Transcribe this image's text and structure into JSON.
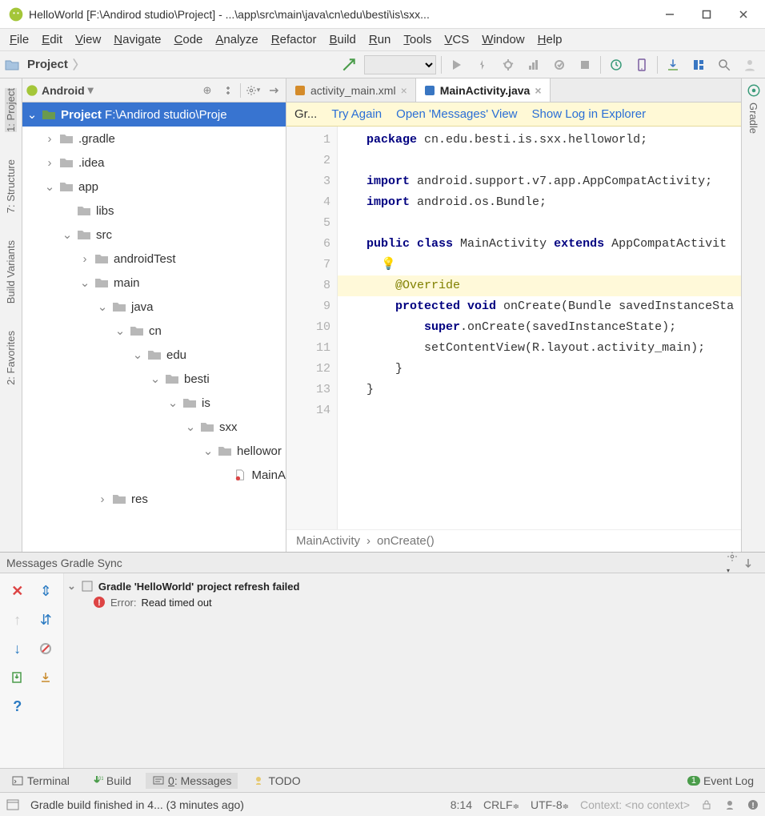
{
  "window": {
    "title": "HelloWorld [F:\\Andirod studio\\Project] - ...\\app\\src\\main\\java\\cn\\edu\\besti\\is\\sxx..."
  },
  "menus": [
    "File",
    "Edit",
    "View",
    "Navigate",
    "Code",
    "Analyze",
    "Refactor",
    "Build",
    "Run",
    "Tools",
    "VCS",
    "Window",
    "Help"
  ],
  "nav_breadcrumb": [
    "Project"
  ],
  "project_pane": {
    "selector_label": "Android",
    "root": {
      "label": "Project",
      "path": "F:\\Andirod studio\\Proje"
    },
    "items": [
      {
        "depth": 1,
        "type": "folder",
        "exp": "closed",
        "name": ".gradle"
      },
      {
        "depth": 1,
        "type": "folder",
        "exp": "closed",
        "name": ".idea"
      },
      {
        "depth": 1,
        "type": "folder",
        "exp": "open",
        "name": "app"
      },
      {
        "depth": 2,
        "type": "folder",
        "exp": "none",
        "name": "libs"
      },
      {
        "depth": 2,
        "type": "folder",
        "exp": "open",
        "name": "src"
      },
      {
        "depth": 3,
        "type": "folder",
        "exp": "closed",
        "name": "androidTest"
      },
      {
        "depth": 3,
        "type": "folder",
        "exp": "open",
        "name": "main"
      },
      {
        "depth": 4,
        "type": "folder",
        "exp": "open",
        "name": "java"
      },
      {
        "depth": 5,
        "type": "folder",
        "exp": "open",
        "name": "cn"
      },
      {
        "depth": 6,
        "type": "folder",
        "exp": "open",
        "name": "edu"
      },
      {
        "depth": 7,
        "type": "folder",
        "exp": "open",
        "name": "besti"
      },
      {
        "depth": 8,
        "type": "folder",
        "exp": "open",
        "name": "is"
      },
      {
        "depth": 9,
        "type": "folder",
        "exp": "open",
        "name": "sxx"
      },
      {
        "depth": 10,
        "type": "folder",
        "exp": "open",
        "name": "hellowor"
      },
      {
        "depth": 11,
        "type": "file",
        "exp": "none",
        "name": "MainA"
      },
      {
        "depth": 4,
        "type": "folder",
        "exp": "closed",
        "name": "res"
      }
    ]
  },
  "editor_tabs": [
    {
      "label": "activity_main.xml",
      "icon": "xml",
      "active": false,
      "closable": true
    },
    {
      "label": "MainActivity.java",
      "icon": "java",
      "active": true,
      "closable": true
    }
  ],
  "editor_notice": {
    "prefix": "Gr...",
    "links": [
      "Try Again",
      "Open 'Messages' View",
      "Show Log in Explorer"
    ]
  },
  "code": {
    "lines": [
      {
        "n": 1,
        "html": "<span class='kw'>package</span> cn.edu.besti.is.sxx.helloworld;"
      },
      {
        "n": 2,
        "html": ""
      },
      {
        "n": 3,
        "html": "<span class='kw'>import</span> android.support.v7.app.AppCompatActivity;"
      },
      {
        "n": 4,
        "html": "<span class='kw'>import</span> android.os.Bundle;"
      },
      {
        "n": 5,
        "html": ""
      },
      {
        "n": 6,
        "html": "<span class='kw'>public class</span> MainActivity <span class='kw'>extends</span> AppCompatActivit"
      },
      {
        "n": 7,
        "html": "  💡",
        "bulb": true
      },
      {
        "n": 8,
        "html": "    <span class='ann'>@Override</span>",
        "hl": true
      },
      {
        "n": 9,
        "html": "    <span class='kw'>protected void</span> onCreate(Bundle savedInstanceSta"
      },
      {
        "n": 10,
        "html": "        <span class='kw'>super</span>.onCreate(savedInstanceState);"
      },
      {
        "n": 11,
        "html": "        setContentView(R.layout.activity_main);"
      },
      {
        "n": 12,
        "html": "    }"
      },
      {
        "n": 13,
        "html": "}"
      },
      {
        "n": 14,
        "html": ""
      }
    ],
    "breadcrumb": [
      "MainActivity",
      "onCreate()"
    ]
  },
  "messages": {
    "title": "Messages Gradle Sync",
    "header": "Gradle 'HelloWorld' project refresh failed",
    "error_label": "Error:",
    "error_msg": "Read timed out"
  },
  "bottom_tools": [
    {
      "icon": "terminal",
      "label": "Terminal",
      "active": false
    },
    {
      "icon": "build",
      "label": "Build",
      "active": false
    },
    {
      "icon": "messages",
      "label": "0: Messages",
      "active": true
    },
    {
      "icon": "todo",
      "label": "TODO",
      "active": false
    }
  ],
  "event_log": {
    "count": "1",
    "label": "Event Log"
  },
  "statusbar": {
    "msg": "Gradle build finished in 4... (3 minutes ago)",
    "pos": "8:14",
    "sep": "CRLF",
    "enc": "UTF-8",
    "context": "Context: <no context>"
  },
  "left_tools": [
    "1: Project",
    "7: Structure",
    "Build Variants",
    "2: Favorites"
  ],
  "right_tools": [
    "Gradle"
  ]
}
